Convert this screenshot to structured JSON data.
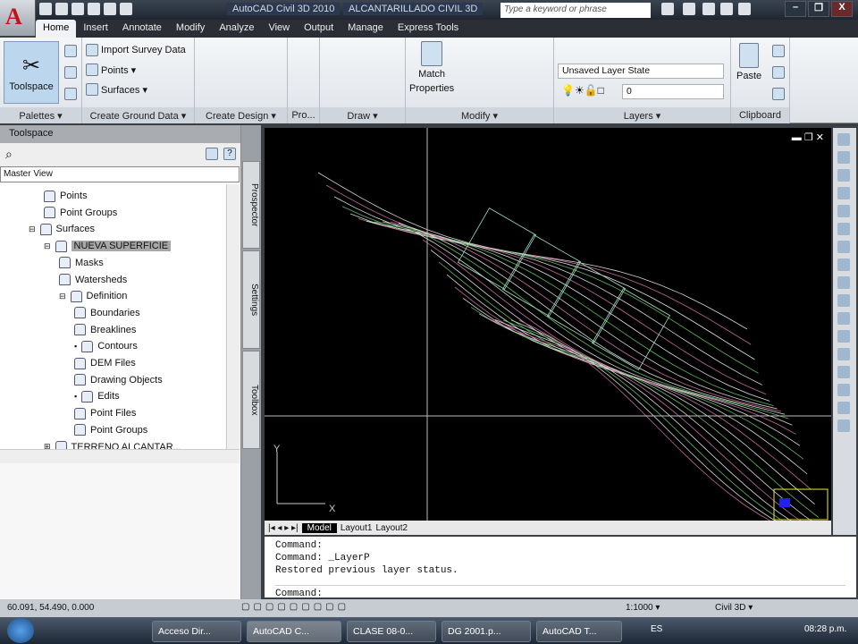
{
  "titlebar": {
    "app": "AutoCAD Civil 3D 2010",
    "file": "ALCANTARILLADO CIVIL 3D",
    "search_placeholder": "Type a keyword or phrase",
    "minimize": "–",
    "restore": "❐",
    "close": "X"
  },
  "tabs": [
    "Home",
    "Insert",
    "Annotate",
    "Modify",
    "Analyze",
    "View",
    "Output",
    "Manage",
    "Express Tools"
  ],
  "ribbon": {
    "toolspace": "Toolspace",
    "import_survey": "Import Survey Data",
    "points": "Points ▾",
    "surfaces": "Surfaces ▾",
    "match1": "Match",
    "match2": "Properties",
    "layer_state": "Unsaved Layer State",
    "layer_current": "0",
    "paste": "Paste",
    "panels": [
      "Palettes ▾",
      "Create Ground Data ▾",
      "Create Design ▾",
      "Pro...",
      "Draw ▾",
      "Modify ▾",
      "Layers ▾",
      "Clipboard"
    ]
  },
  "toolspace": {
    "title": "Toolspace",
    "view": "Master View",
    "tree": [
      {
        "label": "Points",
        "level": 3
      },
      {
        "label": "Point Groups",
        "level": 3
      },
      {
        "label": "Surfaces",
        "level": 2,
        "exp": "⊟"
      },
      {
        "label": "NUEVA SUPERFICIE",
        "level": 3,
        "exp": "⊟",
        "selected": true
      },
      {
        "label": "Masks",
        "level": 4
      },
      {
        "label": "Watersheds",
        "level": 4
      },
      {
        "label": "Definition",
        "level": 4,
        "exp": "⊟"
      },
      {
        "label": "Boundaries",
        "level": 5
      },
      {
        "label": "Breaklines",
        "level": 5
      },
      {
        "label": "Contours",
        "level": 5,
        "exp": "▪"
      },
      {
        "label": "DEM Files",
        "level": 5
      },
      {
        "label": "Drawing Objects",
        "level": 5
      },
      {
        "label": "Edits",
        "level": 5,
        "exp": "▪"
      },
      {
        "label": "Point Files",
        "level": 5
      },
      {
        "label": "Point Groups",
        "level": 5
      },
      {
        "label": "TERRENO ALCANTAR...",
        "level": 3,
        "exp": "⊞"
      }
    ],
    "sidetabs": [
      "Prospector",
      "Settings",
      "Toolbox"
    ]
  },
  "layout_tabs": [
    "Model",
    "Layout1",
    "Layout2"
  ],
  "command_lines": [
    "Command:",
    "Command: _LayerP",
    "Restored previous layer status.",
    "",
    "Command:"
  ],
  "ucs": {
    "x": "X",
    "y": "Y"
  },
  "status": {
    "coords": "60.091, 54.490, 0.000",
    "scale": "1:1000 ▾",
    "workspace": "Civil 3D ▾"
  },
  "taskbar": {
    "items": [
      "Acceso Dir...",
      "AutoCAD C...",
      "CLASE 08-0...",
      "DG 2001.p...",
      "AutoCAD T..."
    ],
    "lang": "ES",
    "time": "08:28 p.m."
  }
}
